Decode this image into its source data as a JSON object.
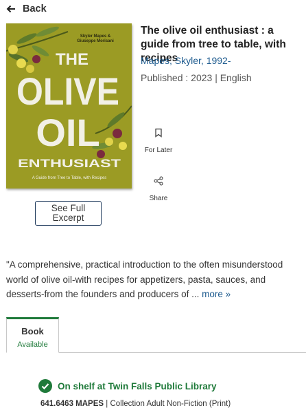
{
  "nav": {
    "back_label": "Back"
  },
  "book": {
    "title": "The olive oil enthusiast : a guide from tree to table, with recipes",
    "author": "Mapes, Skyler, 1992-",
    "published": "Published : 2023 | English",
    "excerpt_label": "See Full Excerpt"
  },
  "cover": {
    "authors": "Skyler Mapes & Giuseppe Morisani",
    "line1": "THE",
    "line2": "OLIVE",
    "line3": "OIL",
    "line4": "ENTHUSIAST",
    "subtitle": "A Guide from Tree to Table, with Recipes",
    "bg_color": "#9a9a22"
  },
  "actions": {
    "for_later": "For Later",
    "share": "Share"
  },
  "description": {
    "text": "\"A comprehensive, practical introduction to the often misunderstood world of olive oil-with recipes for appetizers, pasta, sauces, and desserts-from the founders and producers of ...",
    "more": "more »"
  },
  "format_tab": {
    "label": "Book",
    "status": "Available"
  },
  "availability": {
    "status": "On shelf at Twin Falls Public Library",
    "call_number": "641.6463 MAPES",
    "collection": " | Collection Adult Non-Fiction (Print)"
  },
  "colors": {
    "accent_green": "#1f7a3a",
    "link_blue": "#1c5a8e"
  }
}
